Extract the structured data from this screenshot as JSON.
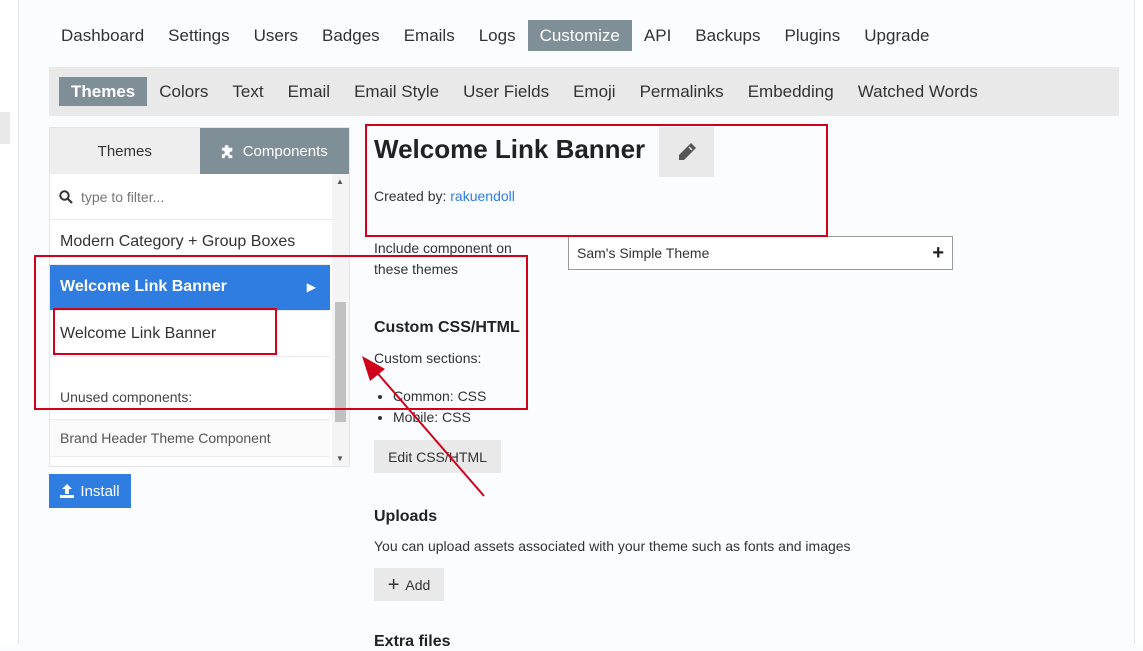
{
  "nav": {
    "items": [
      "Dashboard",
      "Settings",
      "Users",
      "Badges",
      "Emails",
      "Logs",
      "Customize",
      "API",
      "Backups",
      "Plugins",
      "Upgrade"
    ],
    "active": "Customize"
  },
  "subnav": {
    "items": [
      "Themes",
      "Colors",
      "Text",
      "Email",
      "Email Style",
      "User Fields",
      "Emoji",
      "Permalinks",
      "Embedding",
      "Watched Words"
    ],
    "active": "Themes"
  },
  "sidebar": {
    "tab_themes": "Themes",
    "tab_components": "Components",
    "filter_placeholder": "type to filter...",
    "items": [
      "Modern Category + Group Boxes",
      "Welcome Link Banner",
      "Welcome Link Banner"
    ],
    "unused_label": "Unused components:",
    "unused_items": [
      "Brand Header Theme Component"
    ]
  },
  "install_label": "Install",
  "main": {
    "title": "Welcome Link Banner",
    "created_by_label": "Created by:",
    "created_by_user": "rakuendoll",
    "include_label": "Include component on these themes",
    "theme_value": "Sam's Simple Theme",
    "css_heading": "Custom CSS/HTML",
    "custom_sections_label": "Custom sections:",
    "sections": [
      "Common: CSS",
      "Mobile: CSS"
    ],
    "edit_css_label": "Edit CSS/HTML",
    "uploads_heading": "Uploads",
    "uploads_desc": "You can upload assets associated with your theme such as fonts and images",
    "add_label": "Add",
    "extra_heading": "Extra files"
  },
  "colors": {
    "accent": "#2f7de1",
    "nav_active": "#7f8f97",
    "annotation": "#d0021b"
  }
}
